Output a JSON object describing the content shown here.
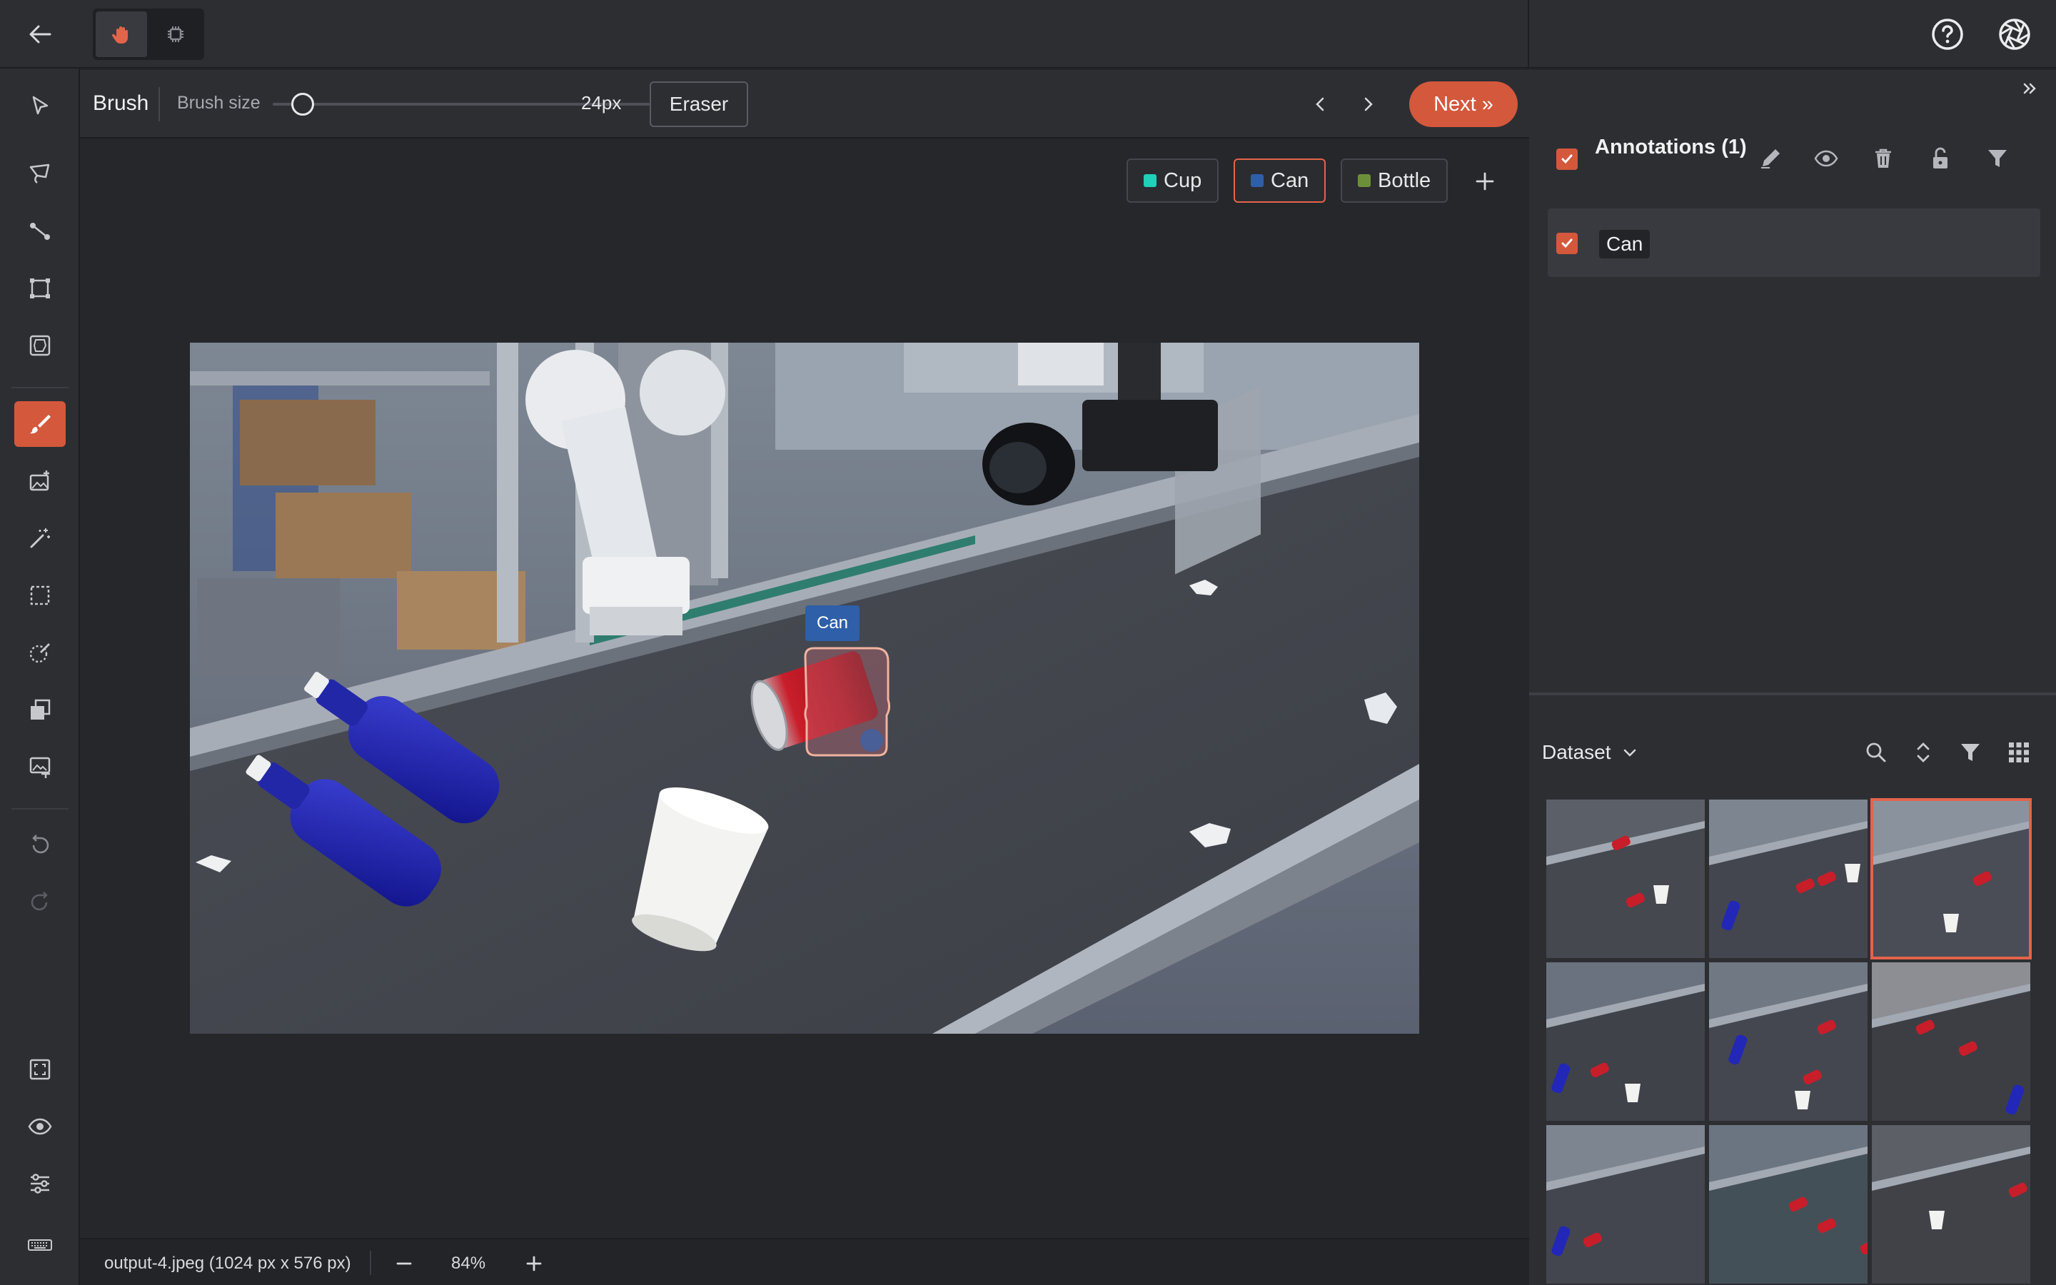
{
  "toolbar": {
    "tool_title": "Brush",
    "brush_size_label": "Brush size",
    "brush_size_value": "24px",
    "brush_size_fraction": 0.08,
    "eraser_label": "Eraser",
    "next_label": "Next »"
  },
  "classes": [
    {
      "label": "Cup",
      "color": "#1fd1b8"
    },
    {
      "label": "Can",
      "color": "#2e5fa8"
    },
    {
      "label": "Bottle",
      "color": "#6e8f3a"
    }
  ],
  "selected_class": "Can",
  "canvas": {
    "annotation_label": "Can",
    "annotation_color": "#2e5fa8"
  },
  "status": {
    "filename": "output-4.jpeg (1024 px x 576 px)",
    "zoom": "84%"
  },
  "annotations_panel": {
    "title": "Annotations (1)",
    "items": [
      {
        "label": "Can"
      }
    ]
  },
  "dataset": {
    "title": "Dataset",
    "thumbnails": [
      {
        "name": "thumb-1",
        "selected": false
      },
      {
        "name": "thumb-2",
        "selected": false
      },
      {
        "name": "thumb-3",
        "selected": true
      },
      {
        "name": "thumb-4",
        "selected": false
      },
      {
        "name": "thumb-5",
        "selected": false
      },
      {
        "name": "thumb-6",
        "selected": false
      },
      {
        "name": "thumb-7",
        "selected": false
      },
      {
        "name": "thumb-8",
        "selected": false
      },
      {
        "name": "thumb-9",
        "selected": false
      }
    ]
  },
  "colors": {
    "accent": "#d4583c",
    "panel": "#2d2e32",
    "background": "#26272b"
  },
  "icons": [
    "back-arrow-icon",
    "hand-icon",
    "chip-icon",
    "help-icon",
    "aperture-icon",
    "pointer-icon",
    "lasso-icon",
    "polyline-icon",
    "bounding-box-icon",
    "polygon-icon",
    "brush-icon",
    "image-fill-icon",
    "magic-wand-icon",
    "marquee-icon",
    "smart-brush-icon",
    "layers-icon",
    "image-text-icon",
    "undo-icon",
    "redo-icon",
    "fit-screen-icon",
    "eye-icon",
    "sliders-icon",
    "keyboard-icon"
  ]
}
